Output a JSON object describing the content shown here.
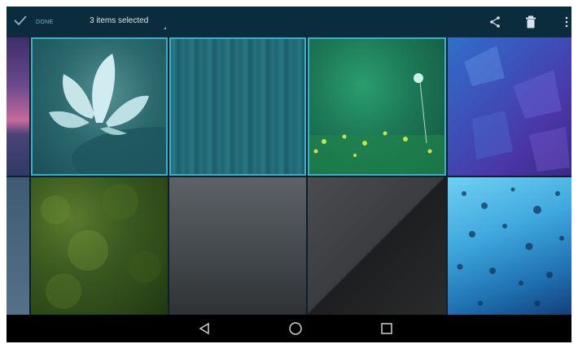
{
  "action_bar": {
    "done_label": "DONE",
    "selection_label": "3 items selected",
    "icons": [
      "share-icon",
      "delete-icon",
      "overflow-menu-icon"
    ]
  },
  "grid": {
    "rows": 2,
    "tiles": [
      {
        "name": "tile-purple-lake",
        "selected": false
      },
      {
        "name": "tile-lotus",
        "selected": true
      },
      {
        "name": "tile-teal-wood",
        "selected": true
      },
      {
        "name": "tile-dandelion",
        "selected": true
      },
      {
        "name": "tile-blue-polygons",
        "selected": false
      },
      {
        "name": "tile-slate-edge",
        "selected": false
      },
      {
        "name": "tile-moss",
        "selected": false
      },
      {
        "name": "tile-gray-gradient",
        "selected": false
      },
      {
        "name": "tile-dark-diagonal",
        "selected": false
      },
      {
        "name": "tile-water-drops",
        "selected": false
      }
    ]
  },
  "nav_bar": {
    "icons": [
      "back-icon",
      "home-icon",
      "recents-icon"
    ]
  }
}
